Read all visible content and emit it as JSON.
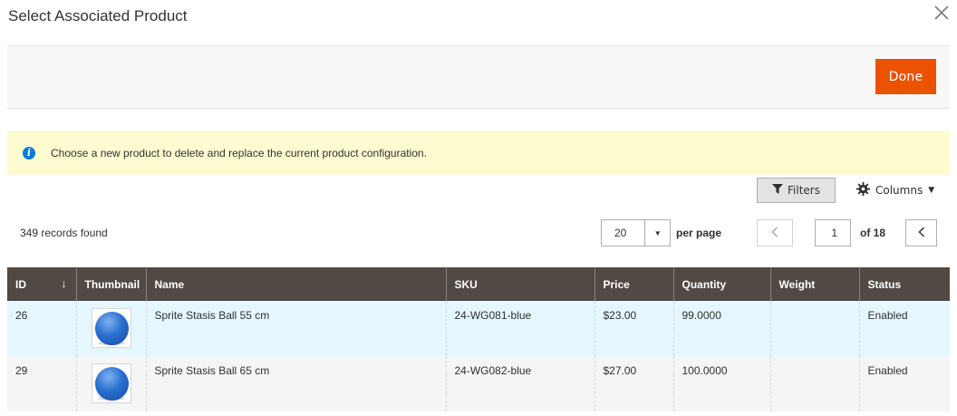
{
  "modal": {
    "title": "Select Associated Product",
    "done_label": "Done"
  },
  "notice": {
    "text": "Choose a new product to delete and replace the current product configuration."
  },
  "toolbar": {
    "filters_label": "Filters",
    "columns_label": "Columns"
  },
  "records_found": "349 records found",
  "pagination": {
    "per_page_value": "20",
    "per_page_label": "per page",
    "current_page": "1",
    "of_label": "of 18"
  },
  "grid": {
    "columns": [
      "ID",
      "Thumbnail",
      "Name",
      "SKU",
      "Price",
      "Quantity",
      "Weight",
      "Status"
    ],
    "sorted_column": "ID",
    "rows": [
      {
        "id": "26",
        "name": "Sprite Stasis Ball 55 cm",
        "sku": "24-WG081-blue",
        "price": "$23.00",
        "quantity": "99.0000",
        "weight": "",
        "status": "Enabled"
      },
      {
        "id": "29",
        "name": "Sprite Stasis Ball 65 cm",
        "sku": "24-WG082-blue",
        "price": "$27.00",
        "quantity": "100.0000",
        "weight": "",
        "status": "Enabled"
      }
    ]
  },
  "colors": {
    "accent": "#eb5202",
    "header_bg": "#514943",
    "notice_bg": "#fdfbd0",
    "row_highlight": "#e5f7fe",
    "info_icon": "#007bdb"
  },
  "icons": [
    "close-icon",
    "info-icon",
    "filter-icon",
    "gear-icon",
    "chevron-down-icon",
    "chevron-left-icon",
    "sort-down-icon"
  ]
}
